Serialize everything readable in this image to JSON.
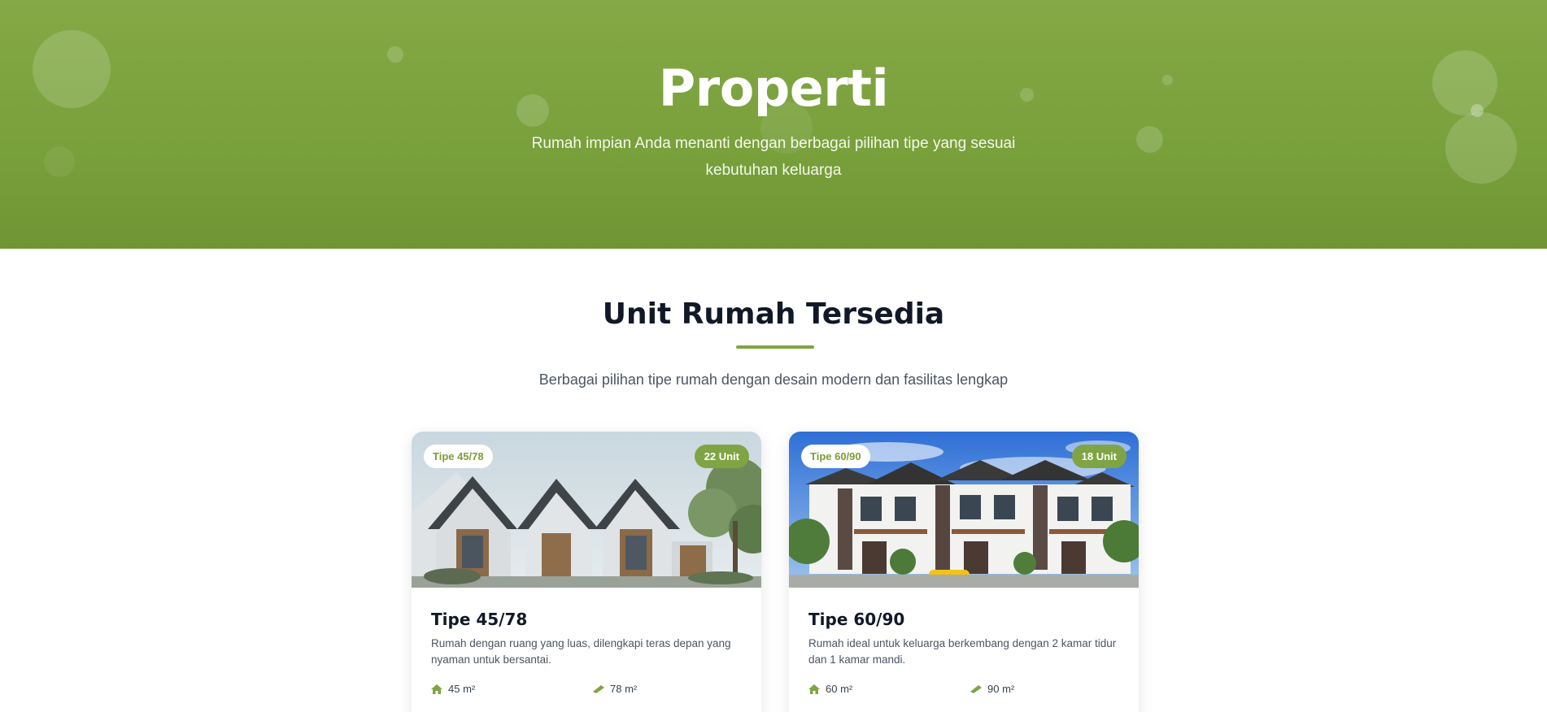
{
  "hero": {
    "title": "Properti",
    "subtitle": "Rumah impian Anda menanti dengan berbagai pilihan tipe yang sesuai kebutuhan keluarga"
  },
  "section": {
    "title": "Unit Rumah Tersedia",
    "subtitle": "Berbagai pilihan tipe rumah dengan desain modern dan fasilitas lengkap"
  },
  "colors": {
    "brand_green": "#7fa443",
    "heading": "#111827",
    "body_text": "#4b5563"
  },
  "properties": [
    {
      "type_badge": "Tipe 45/78",
      "units_badge": "22 Unit",
      "title": "Tipe 45/78",
      "description": "Rumah dengan ruang yang luas, dilengkapi teras depan yang nyaman untuk bersantai.",
      "building_area": "45 m²",
      "land_area": "78 m²",
      "building_icon": "home-icon",
      "land_icon": "ruler-icon"
    },
    {
      "type_badge": "Tipe 60/90",
      "units_badge": "18 Unit",
      "title": "Tipe 60/90",
      "description": "Rumah ideal untuk keluarga berkembang dengan 2 kamar tidur dan 1 kamar mandi.",
      "building_area": "60 m²",
      "land_area": "90 m²",
      "building_icon": "home-icon",
      "land_icon": "ruler-icon"
    }
  ]
}
